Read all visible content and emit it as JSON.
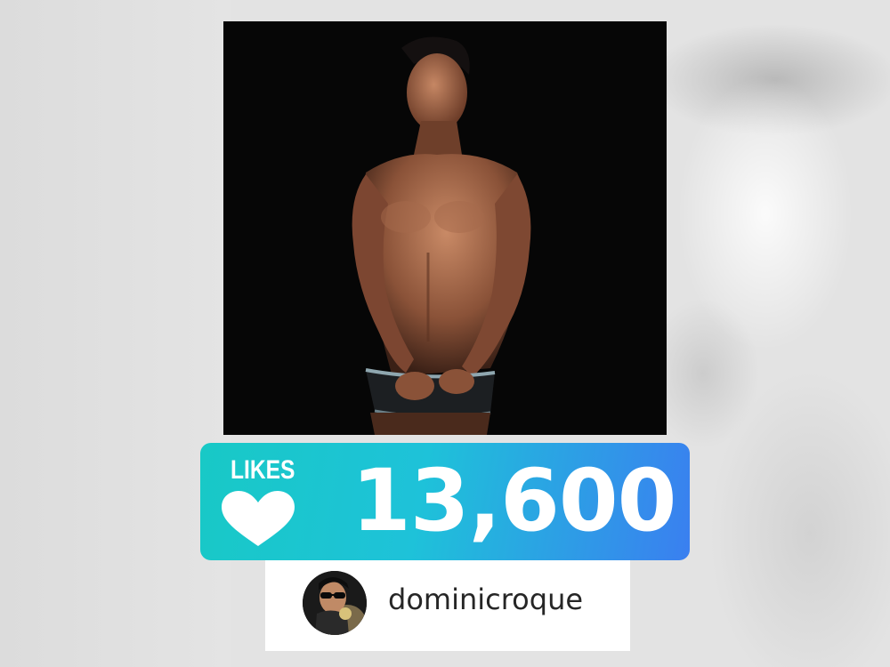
{
  "post": {
    "photo_icon": "shirtless-portrait-photo"
  },
  "likes": {
    "label": "LIKES",
    "count": "13,600",
    "icon": "heart-icon",
    "gradient_start": "#18c9c6",
    "gradient_end": "#3a7ff0"
  },
  "user": {
    "username": "dominicroque",
    "avatar_icon": "avatar-with-sunglasses"
  }
}
